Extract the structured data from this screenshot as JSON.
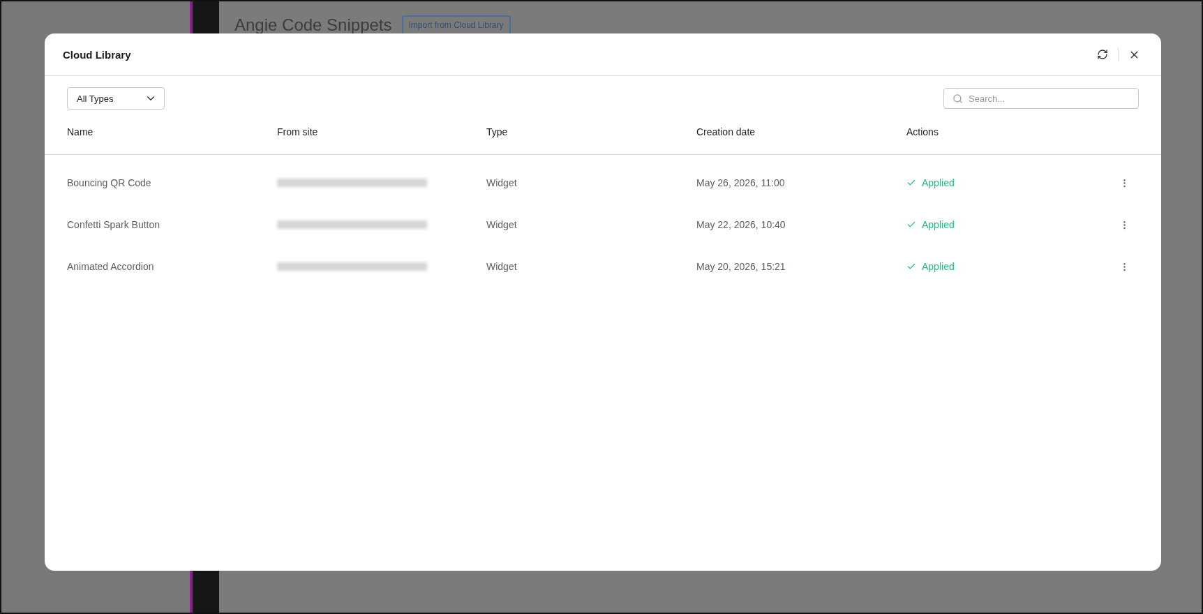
{
  "background": {
    "title": "Angie Code Snippets",
    "import_button": "Import from Cloud Library"
  },
  "modal": {
    "title": "Cloud Library",
    "filter": {
      "value": "All Types"
    },
    "search": {
      "placeholder": "Search..."
    },
    "table": {
      "columns": [
        "Name",
        "From site",
        "Type",
        "Creation date",
        "Actions"
      ],
      "rows": [
        {
          "name": "Bouncing QR Code",
          "from_site_redacted": true,
          "type": "Widget",
          "date": "May 26, 2026, 11:00",
          "status": "Applied"
        },
        {
          "name": "Confetti Spark Button",
          "from_site_redacted": true,
          "type": "Widget",
          "date": "May 22, 2026, 10:40",
          "status": "Applied"
        },
        {
          "name": "Animated Accordion",
          "from_site_redacted": true,
          "type": "Widget",
          "date": "May 20, 2026, 15:21",
          "status": "Applied"
        }
      ]
    }
  }
}
